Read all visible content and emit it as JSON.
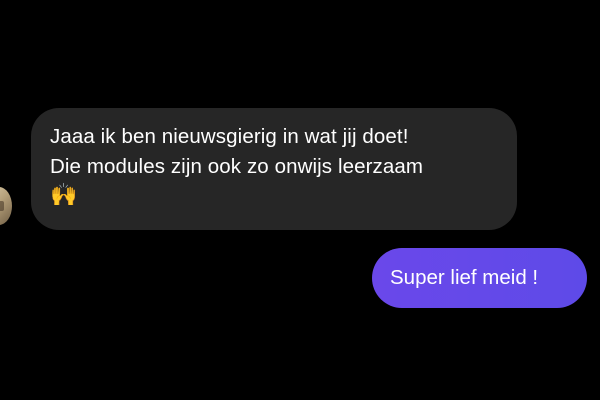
{
  "chat": {
    "incoming": {
      "line1": "Jaaa ik ben nieuwsgierig in wat jij doet!",
      "line2": "Die modules zijn ook zo onwijs leerzaam",
      "emoji": "🙌",
      "emoji_icon": "raising-hands-icon"
    },
    "outgoing": {
      "text": "Super lief meid !"
    }
  },
  "colors": {
    "background": "#000000",
    "incoming_bubble": "#262626",
    "outgoing_bubble": "#6246ea",
    "text": "#ffffff"
  }
}
